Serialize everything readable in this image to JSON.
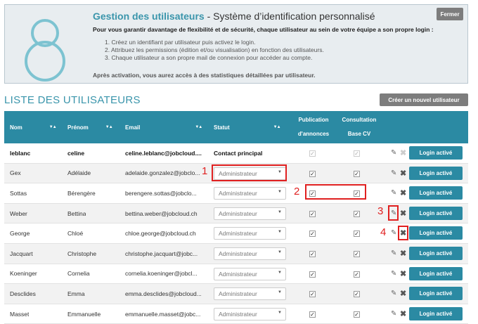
{
  "info": {
    "title_bold": "Gestion des utilisateurs",
    "title_rest": " - Système d’identification personnalisé",
    "lead": "Pour vous garantir davantage de flexibilité et de sécurité, chaque utilisateur au sein de votre équipe a son propre login :",
    "steps": [
      "1. Créez un identifiant par utilisateur puis activez le login.",
      "2. Attribuez les permissions (édition et/ou visualisation) en fonction des utilisateurs.",
      "3. Chaque utilisateur a son propre mail de connexion pour accéder au compte."
    ],
    "after": "Après activation, vous aurez accès à des statistiques détaillées par utilisateur.",
    "close_label": "Fermer"
  },
  "section": {
    "title": "LISTE DES UTILISATEURS",
    "create_label": "Créer un nouvel utilisateur"
  },
  "table": {
    "headers": {
      "nom": "Nom",
      "prenom": "Prénom",
      "email": "Email",
      "statut": "Statut",
      "publication_1": "Publication",
      "publication_2": "d'annonces",
      "consultation_1": "Consultation",
      "consultation_2": "Base CV"
    },
    "rows": [
      {
        "nom": "leblanc",
        "prenom": "celine",
        "email": "celine.leblanc@jobcloud....",
        "statut": "Contact principal",
        "login": "Login activé"
      },
      {
        "nom": "Gex",
        "prenom": "Adélaide",
        "email": "adelaide.gonzalez@jobclo...",
        "statut": "Administrateur",
        "login": "Login activé"
      },
      {
        "nom": "Sottas",
        "prenom": "Bérengère",
        "email": "berengere.sottas@jobclo...",
        "statut": "Administrateur",
        "login": "Login activé"
      },
      {
        "nom": "Weber",
        "prenom": "Bettina",
        "email": "bettina.weber@jobcloud.ch",
        "statut": "Administrateur",
        "login": "Login activé"
      },
      {
        "nom": "George",
        "prenom": "Chloé",
        "email": "chloe.george@jobcloud.ch",
        "statut": "Administrateur",
        "login": "Login activé"
      },
      {
        "nom": "Jacquart",
        "prenom": "Christophe",
        "email": "christophe.jacquart@jobc...",
        "statut": "Administrateur",
        "login": "Login activé"
      },
      {
        "nom": "Koeninger",
        "prenom": "Cornelia",
        "email": "cornelia.koeninger@jobcl...",
        "statut": "Administrateur",
        "login": "Login activé"
      },
      {
        "nom": "Desclides",
        "prenom": "Emma",
        "email": "emma.desclides@jobcloud...",
        "statut": "Administrateur",
        "login": "Login activé"
      },
      {
        "nom": "Masset",
        "prenom": "Emmanuelle",
        "email": "emmanuelle.masset@jobc...",
        "statut": "Administrateur",
        "login": "Login activé"
      }
    ]
  },
  "annotations": [
    "1",
    "2",
    "3",
    "4"
  ],
  "colors": {
    "accent": "#2b8aa3",
    "annotation": "#e02020"
  },
  "icons": [
    "logo-8-icon",
    "sort-icon",
    "pencil-icon",
    "delete-icon",
    "dropdown-caret-icon",
    "checkbox-icon"
  ]
}
